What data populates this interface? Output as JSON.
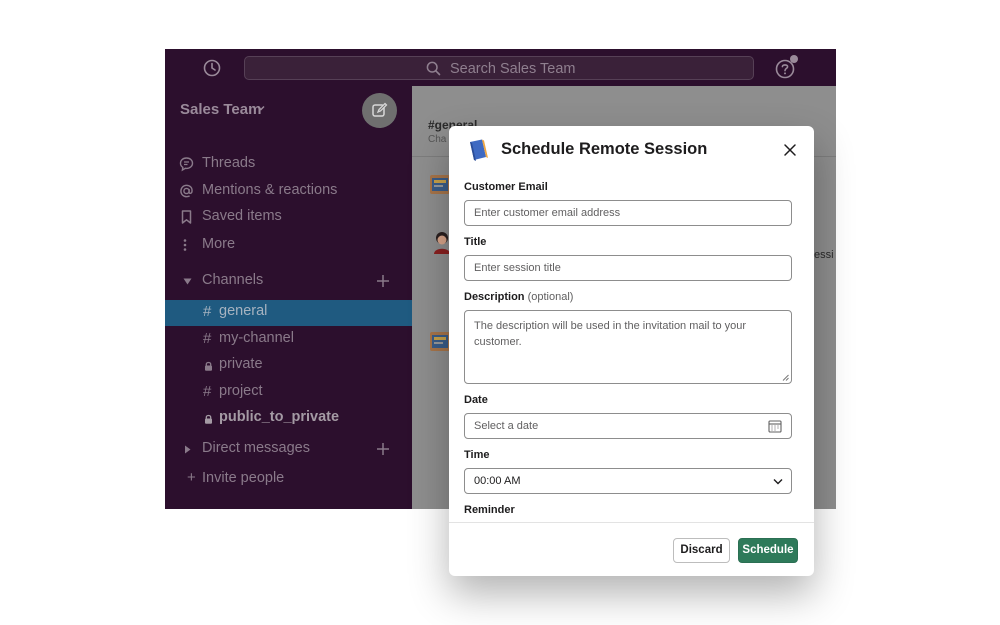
{
  "search": {
    "placeholder": "Search Sales Team"
  },
  "sidebar": {
    "team_name": "Sales Team",
    "nav": [
      {
        "label": "Threads",
        "icon": "threads-icon"
      },
      {
        "label": "Mentions & reactions",
        "icon": "at-icon"
      },
      {
        "label": "Saved items",
        "icon": "bookmark-icon"
      },
      {
        "label": "More",
        "icon": "more-vertical-icon"
      }
    ],
    "channels_label": "Channels",
    "channels": [
      {
        "prefix": "#",
        "label": "general",
        "active": true
      },
      {
        "prefix": "#",
        "label": "my-channel"
      },
      {
        "prefix": "lock",
        "label": "private"
      },
      {
        "prefix": "#",
        "label": "project"
      },
      {
        "prefix": "lock",
        "label": "public_to_private",
        "bold": true
      }
    ],
    "dm_label": "Direct messages",
    "invite_label": "Invite people",
    "invite_prefix": "+"
  },
  "main": {
    "channel_title": "#general",
    "channel_sub": "Cha",
    "bleed_text": "essi"
  },
  "modal": {
    "title": "Schedule Remote Session",
    "email": {
      "label": "Customer Email",
      "placeholder": "Enter customer email address"
    },
    "title_field": {
      "label": "Title",
      "placeholder": "Enter session title"
    },
    "description": {
      "label": "Description",
      "note": "(optional)",
      "placeholder": "The description will be used in the invitation mail to your customer."
    },
    "date": {
      "label": "Date",
      "placeholder": "Select a date"
    },
    "time": {
      "label": "Time",
      "value": "00:00 AM"
    },
    "reminder": {
      "label": "Reminder"
    },
    "discard_label": "Discard",
    "schedule_label": "Schedule"
  },
  "colors": {
    "sidebar_bg": "#2c0f2d",
    "active_channel": "#1f5a80",
    "primary_button": "#2e7a5a",
    "overlay": "#8e8e8e"
  }
}
